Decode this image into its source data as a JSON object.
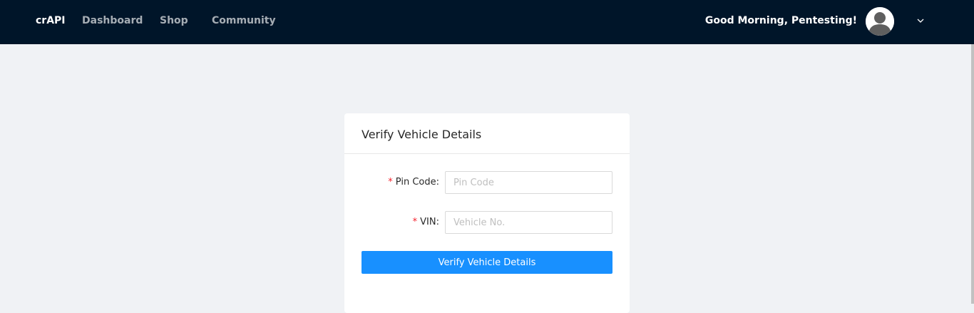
{
  "header": {
    "brand": "crAPI",
    "nav": [
      {
        "label": "Dashboard"
      },
      {
        "label": "Shop"
      },
      {
        "label": "Community"
      }
    ],
    "greeting": "Good Morning, Pentesting!",
    "avatar_icon": "user-avatar-icon",
    "dropdown_icon": "chevron-down-icon"
  },
  "card": {
    "title": "Verify Vehicle Details",
    "fields": [
      {
        "label": "Pin Code",
        "required_mark": "*",
        "separator": ":",
        "placeholder": "Pin Code",
        "value": ""
      },
      {
        "label": "VIN",
        "required_mark": "*",
        "separator": ":",
        "placeholder": "Vehicle No.",
        "value": ""
      }
    ],
    "submit_label": "Verify Vehicle Details"
  },
  "colors": {
    "header_bg": "#001529",
    "page_bg": "#f0f2f5",
    "primary": "#1890ff",
    "required": "#f5222d"
  }
}
